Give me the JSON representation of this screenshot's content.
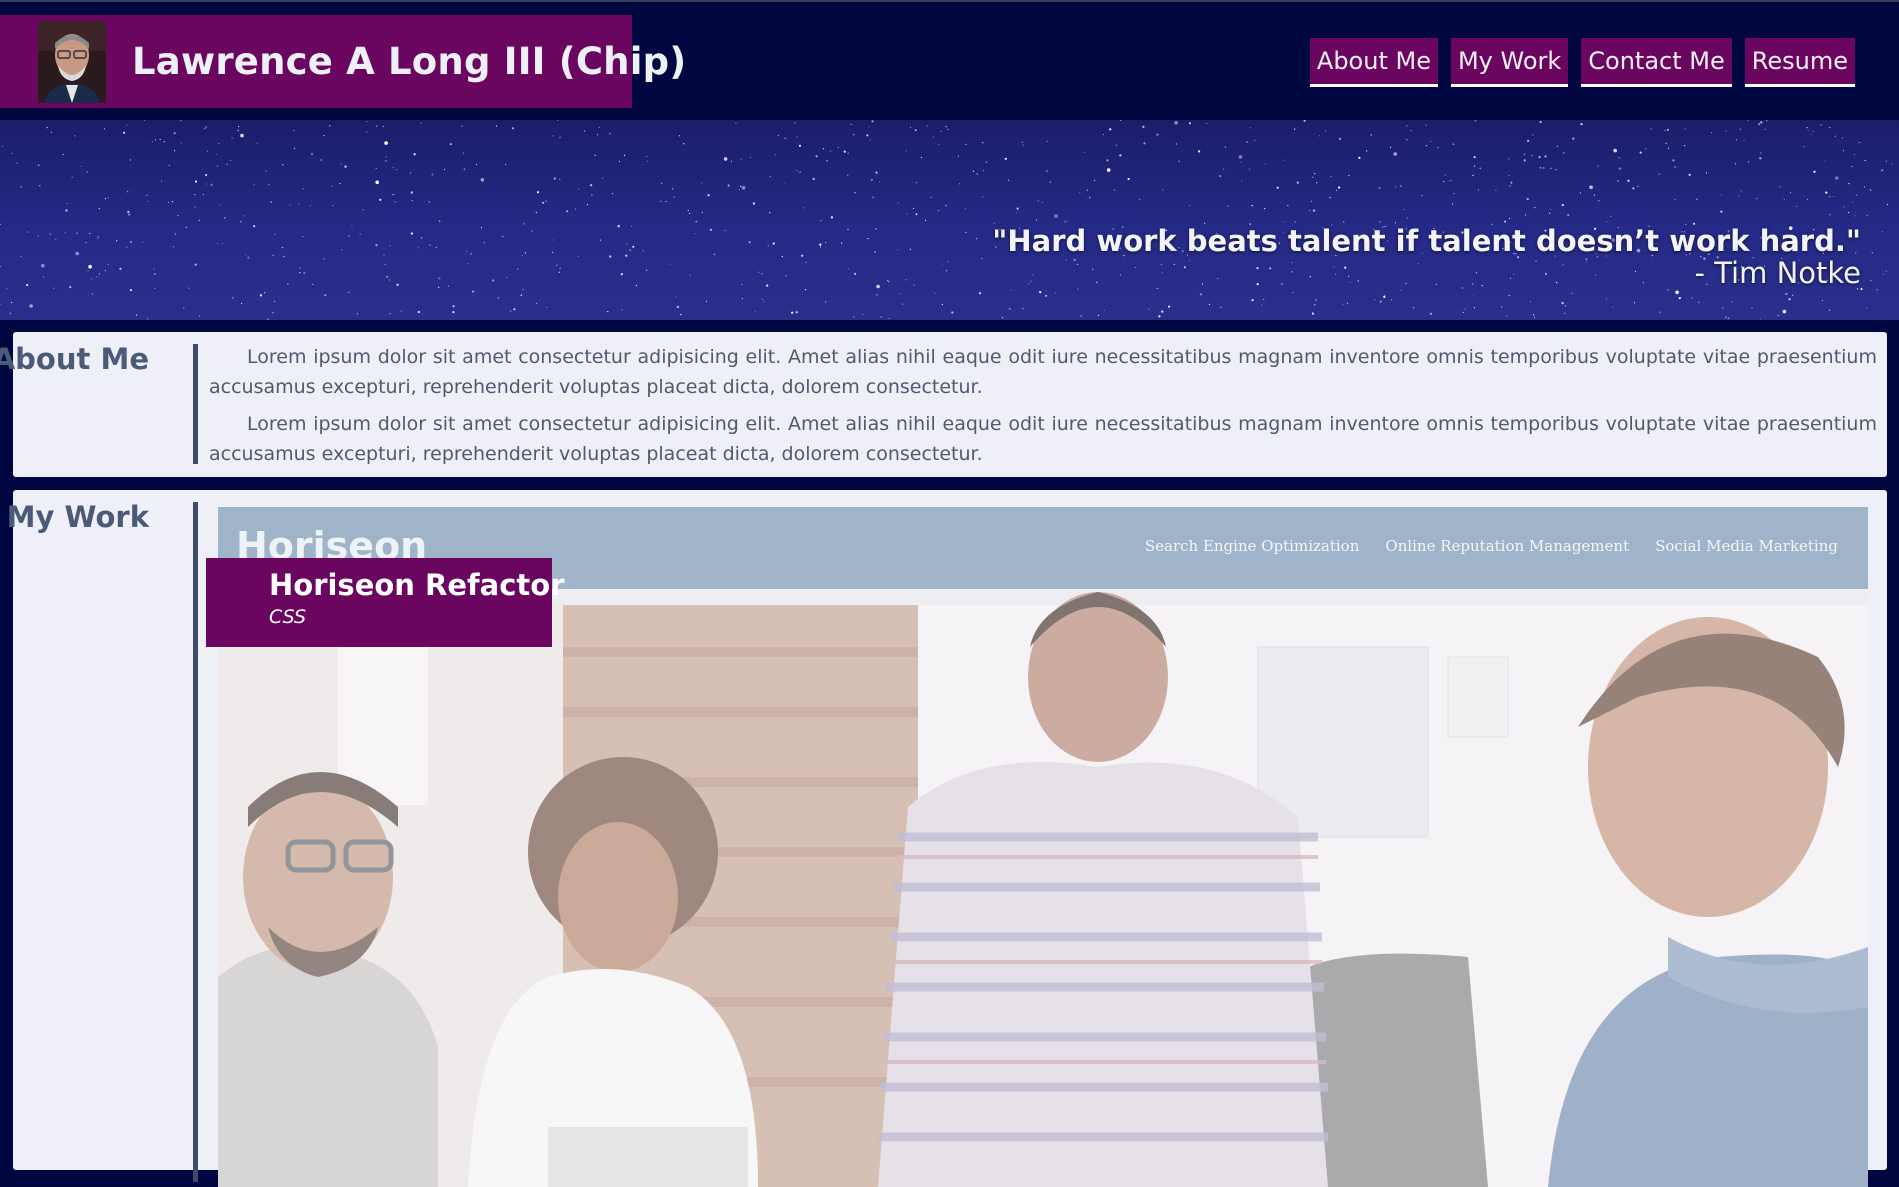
{
  "header": {
    "name": "Lawrence A Long III (Chip)",
    "avatar_icon": "profile-photo",
    "nav": [
      {
        "label": "About Me"
      },
      {
        "label": "My Work"
      },
      {
        "label": "Contact Me"
      },
      {
        "label": "Resume"
      }
    ]
  },
  "hero": {
    "quote": "\"Hard work beats talent if talent doesn’t work hard.\"",
    "author": "- Tim Notke"
  },
  "about": {
    "heading": "About Me",
    "paragraphs": [
      "Lorem ipsum dolor sit amet consectetur adipisicing elit. Amet alias nihil eaque odit iure necessitatibus magnam inventore omnis temporibus voluptate vitae praesentium accusamus excepturi, reprehenderit voluptas placeat dicta, dolorem consectetur.",
      "Lorem ipsum dolor sit amet consectetur adipisicing elit. Amet alias nihil eaque odit iure necessitatibus magnam inventore omnis temporibus voluptate vitae praesentium accusamus excepturi, reprehenderit voluptas placeat dicta, dolorem consectetur."
    ]
  },
  "work": {
    "heading": "My Work",
    "projects": [
      {
        "title": "Horiseon Refactor",
        "tech": "CSS",
        "screenshot": {
          "logo": "Horiseon",
          "links": [
            "Search Engine Optimization",
            "Online Reputation Management",
            "Social Media Marketing"
          ]
        }
      }
    ]
  },
  "colors": {
    "page_bg": "#000740",
    "accent": "#6b0660",
    "section_bg": "#eeeff7",
    "heading": "#4b5a78"
  }
}
